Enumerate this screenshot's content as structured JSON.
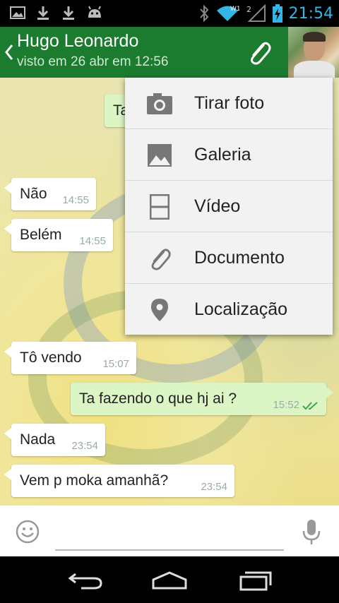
{
  "status_bar": {
    "left_icons": [
      "image-icon",
      "download-icon",
      "download-icon",
      "android-icon"
    ],
    "right_icons": [
      "bluetooth-icon",
      "wifi-icon",
      "signal-icon",
      "battery-icon"
    ],
    "wifi_tag": "W1",
    "signal_tag": "2",
    "time": "21:54",
    "accent_color": "#33b5e5"
  },
  "header": {
    "contact_name": "Hugo Leonardo",
    "last_seen": "visto em 26 abr em 12:56",
    "bar_color": "#1b7b2e"
  },
  "messages": [
    {
      "direction": "in",
      "text": "Não",
      "time": "14:55"
    },
    {
      "direction": "in",
      "text": "Belém",
      "time": "14:55"
    },
    {
      "direction": "in",
      "text": "Tô vendo",
      "time": "15:07"
    },
    {
      "direction": "out",
      "text": "Ta fazendo o que hj ai ?",
      "time": "15:52",
      "status": "read"
    },
    {
      "direction": "in",
      "text": "Nada",
      "time": "23:54"
    },
    {
      "direction": "in",
      "text": "Vem p moka amanhã?",
      "time": "23:54"
    }
  ],
  "partial_out_bubble_text": "Ta",
  "attach_menu": {
    "items": [
      {
        "label": "Tirar foto",
        "icon": "camera-icon"
      },
      {
        "label": "Galeria",
        "icon": "gallery-icon"
      },
      {
        "label": "Vídeo",
        "icon": "video-icon"
      },
      {
        "label": "Documento",
        "icon": "paperclip-icon"
      },
      {
        "label": "Localização",
        "icon": "location-pin-icon"
      }
    ]
  },
  "input": {
    "placeholder": ""
  }
}
